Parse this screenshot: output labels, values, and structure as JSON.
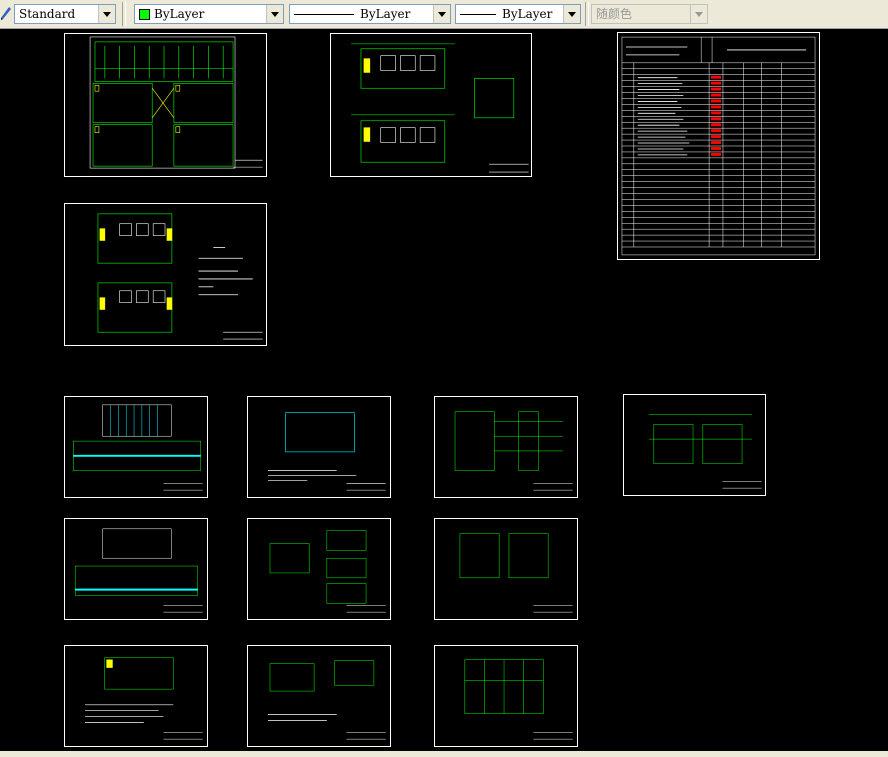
{
  "toolbar": {
    "text_style": "Standard",
    "color": "ByLayer",
    "linetype": "ByLayer",
    "lineweight": "ByLayer",
    "plot_style": "随颜色"
  },
  "sheets": {
    "cover_title_left": "",
    "index_table_title": ""
  },
  "colors": {
    "canvas": "#000000",
    "drawing": "#00ff00",
    "frame": "#ffffff",
    "highlight": "#ffff00",
    "alert": "#ff0000",
    "cyan": "#00ffff",
    "magenta": "#ff00ff"
  },
  "icons": [
    "draw-tool-icon",
    "dropdown-arrow-icon"
  ]
}
